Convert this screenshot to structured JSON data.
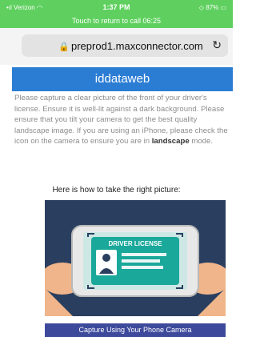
{
  "status_bar": {
    "carrier": "Verizon",
    "time": "1:37 PM",
    "battery": "87%",
    "call_banner": "Touch to return to call 06:25"
  },
  "browser": {
    "url": "preprod1.maxconnector.com",
    "lock_icon": "lock-icon",
    "reload_icon": "reload-icon"
  },
  "header": {
    "title": "iddataweb",
    "color": "#2b7dd4"
  },
  "instructions": {
    "text_before": "Please capture a clear picture of the front of your driver's license. Ensure it is well-lit against a dark background. Please ensure that you tilt your camera to get the best quality landscape image. If you are using an iPhone, please check the icon on the camera to ensure you are in",
    "emphasis": "landscape",
    "text_after": "mode."
  },
  "howto_label": "Here is how to take the right picture:",
  "illustration": {
    "card_label": "DRIVER LICENSE"
  },
  "cta_button": {
    "label": "Capture Using Your Phone Camera",
    "color": "#3d4a9c"
  }
}
